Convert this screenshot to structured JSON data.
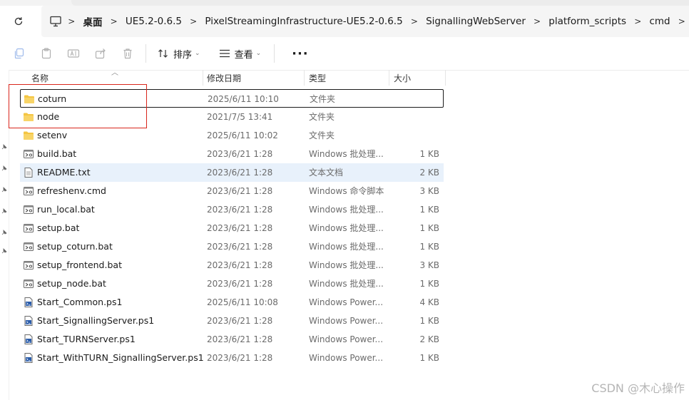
{
  "breadcrumb": {
    "items": [
      "桌面",
      "UE5.2-0.6.5",
      "PixelStreamingInfrastructure-UE5.2-0.6.5",
      "SignallingWebServer",
      "platform_scripts",
      "cmd"
    ],
    "separator": ">"
  },
  "toolbar": {
    "sort_label": "排序",
    "view_label": "查看",
    "more_label": "···"
  },
  "columns": {
    "name": "名称",
    "date": "修改日期",
    "type": "类型",
    "size": "大小"
  },
  "files": [
    {
      "name": "coturn",
      "date": "2025/6/11 10:10",
      "type": "文件夹",
      "size": "",
      "icon": "folder-icon"
    },
    {
      "name": "node",
      "date": "2021/7/5 13:41",
      "type": "文件夹",
      "size": "",
      "icon": "folder-icon"
    },
    {
      "name": "setenv",
      "date": "2025/6/11 10:02",
      "type": "文件夹",
      "size": "",
      "icon": "folder-icon"
    },
    {
      "name": "build.bat",
      "date": "2023/6/21 1:28",
      "type": "Windows 批处理...",
      "size": "1 KB",
      "icon": "batch-file-icon"
    },
    {
      "name": "README.txt",
      "date": "2023/6/21 1:28",
      "type": "文本文档",
      "size": "2 KB",
      "icon": "text-file-icon"
    },
    {
      "name": "refreshenv.cmd",
      "date": "2023/6/21 1:28",
      "type": "Windows 命令脚本",
      "size": "3 KB",
      "icon": "batch-file-icon"
    },
    {
      "name": "run_local.bat",
      "date": "2023/6/21 1:28",
      "type": "Windows 批处理...",
      "size": "1 KB",
      "icon": "batch-file-icon"
    },
    {
      "name": "setup.bat",
      "date": "2023/6/21 1:28",
      "type": "Windows 批处理...",
      "size": "1 KB",
      "icon": "batch-file-icon"
    },
    {
      "name": "setup_coturn.bat",
      "date": "2023/6/21 1:28",
      "type": "Windows 批处理...",
      "size": "1 KB",
      "icon": "batch-file-icon"
    },
    {
      "name": "setup_frontend.bat",
      "date": "2023/6/21 1:28",
      "type": "Windows 批处理...",
      "size": "3 KB",
      "icon": "batch-file-icon"
    },
    {
      "name": "setup_node.bat",
      "date": "2023/6/21 1:28",
      "type": "Windows 批处理...",
      "size": "1 KB",
      "icon": "batch-file-icon"
    },
    {
      "name": "Start_Common.ps1",
      "date": "2025/6/11 10:08",
      "type": "Windows Power...",
      "size": "4 KB",
      "icon": "powershell-file-icon"
    },
    {
      "name": "Start_SignallingServer.ps1",
      "date": "2023/6/21 1:28",
      "type": "Windows Power...",
      "size": "1 KB",
      "icon": "powershell-file-icon"
    },
    {
      "name": "Start_TURNServer.ps1",
      "date": "2023/6/21 1:28",
      "type": "Windows Power...",
      "size": "2 KB",
      "icon": "powershell-file-icon"
    },
    {
      "name": "Start_WithTURN_SignallingServer.ps1",
      "date": "2023/6/21 1:28",
      "type": "Windows Power...",
      "size": "1 KB",
      "icon": "powershell-file-icon"
    }
  ],
  "watermark": "CSDN @木心操作",
  "colors": {
    "folder": "#f4c542",
    "annotation": "#d9261c",
    "hover_row": "#e8f1fb"
  }
}
